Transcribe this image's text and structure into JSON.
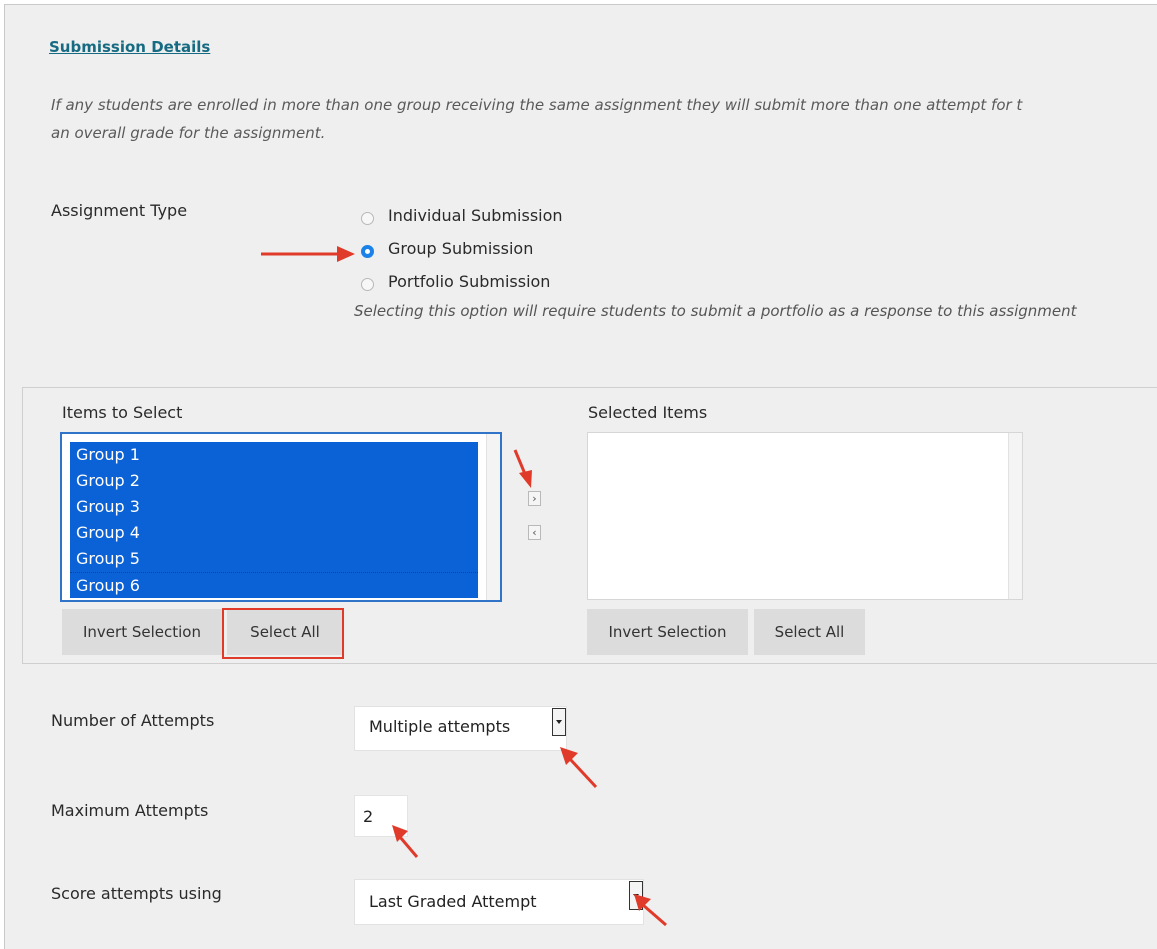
{
  "section": {
    "title": "Submission Details",
    "note_line1": "If any students are enrolled in more than one group receiving the same assignment they will submit more than one attempt for t",
    "note_line2": "an overall grade for the assignment."
  },
  "assignment_type": {
    "label": "Assignment Type",
    "options": [
      {
        "label": "Individual Submission",
        "selected": false
      },
      {
        "label": "Group Submission",
        "selected": true
      },
      {
        "label": "Portfolio Submission",
        "selected": false
      }
    ],
    "portfolio_help": "Selecting this option will require students to submit a portfolio as a response to this assignment"
  },
  "picker": {
    "available_label": "Items to Select",
    "selected_label": "Selected Items",
    "available_items": [
      "Group 1",
      "Group 2",
      "Group 3",
      "Group 4",
      "Group 5",
      "Group 6"
    ],
    "selected_items": [],
    "move_right_glyph": "›",
    "move_left_glyph": "‹",
    "invert_label": "Invert Selection",
    "select_all_label": "Select All"
  },
  "attempts": {
    "number_label": "Number of Attempts",
    "number_value": "Multiple attempts",
    "max_label": "Maximum Attempts",
    "max_value": "2",
    "score_label": "Score attempts using",
    "score_value": "Last Graded Attempt"
  },
  "colors": {
    "accent_link": "#166b82",
    "selection_blue": "#0b62d6",
    "annotation_red": "#e03b2a"
  },
  "icons": [
    "radio-icon",
    "chevron-right-icon",
    "chevron-left-icon",
    "caret-down-icon",
    "annotation-arrow-icon"
  ]
}
